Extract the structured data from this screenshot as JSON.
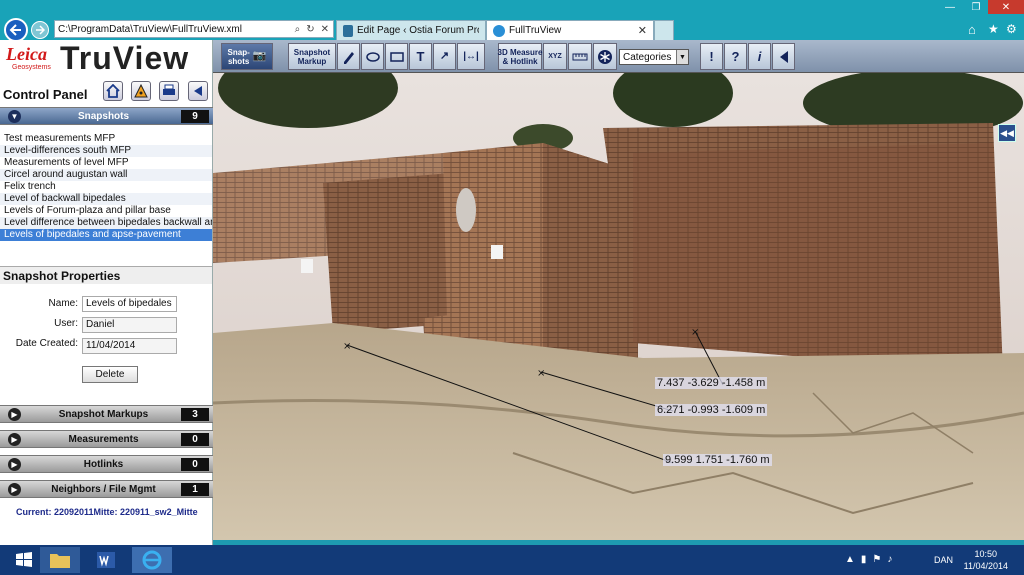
{
  "browser": {
    "address": "C:\\ProgramData\\TruView\\FullTruView.xml",
    "tabs": [
      {
        "label": "Edit Page ‹ Ostia Forum Projec..."
      },
      {
        "label": "FullTruView"
      }
    ]
  },
  "brand": {
    "leica": "Leica",
    "geosystems": "Geosystems",
    "product": "TruView"
  },
  "panel": {
    "title": "Control Panel",
    "snapshots_label": "Snapshots",
    "snapshots_count": "9",
    "snapshots": [
      "Test measurements MFP",
      "Level-differences south MFP",
      "Measurements of level MFP",
      "Circel around augustan wall",
      "Felix trench",
      "Level of backwall bipedales",
      "Levels of Forum-plaza and pillar base",
      "Level difference between bipedales backwall and...",
      "Levels of bipedales and apse-pavement"
    ],
    "props_title": "Snapshot Properties",
    "name_label": "Name:",
    "name_value": "Levels of bipedales",
    "user_label": "User:",
    "user_value": "Daniel",
    "date_label": "Date Created:",
    "date_value": "11/04/2014",
    "delete_label": "Delete",
    "sections": [
      {
        "label": "Snapshot Markups",
        "count": "3"
      },
      {
        "label": "Measurements",
        "count": "0"
      },
      {
        "label": "Hotlinks",
        "count": "0"
      },
      {
        "label": "Neighbors / File Mgmt",
        "count": "1"
      }
    ],
    "current": "Current: 22092011Mitte: 220911_sw2_Mitte"
  },
  "toolbar": {
    "snapshots": "Snap-\nshots",
    "snapshot_markup": "Snapshot\nMarkup",
    "measure": "3D Measure\n& Hotlink",
    "categories": "Categories"
  },
  "measurements": [
    "7.437 -3.629 -1.458 m",
    "6.271 -0.993 -1.609 m",
    "9.599 1.751 -1.760 m"
  ],
  "clock": {
    "time": "10:50",
    "date": "11/04/2014",
    "lang": "DAN"
  }
}
